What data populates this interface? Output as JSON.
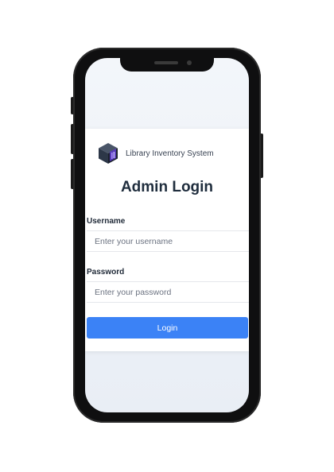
{
  "app": {
    "name": "Library Inventory System"
  },
  "login": {
    "title": "Admin Login",
    "username_label": "Username",
    "username_placeholder": "Enter your username",
    "username_value": "",
    "password_label": "Password",
    "password_placeholder": "Enter your password",
    "password_value": "",
    "submit_label": "Login"
  },
  "icons": {
    "brand": "cube-logo-icon"
  },
  "colors": {
    "accent": "#3b82f6",
    "title": "#1f2d3d",
    "logo_body": "#2f3b4c",
    "logo_accent": "#5b3cc4"
  }
}
